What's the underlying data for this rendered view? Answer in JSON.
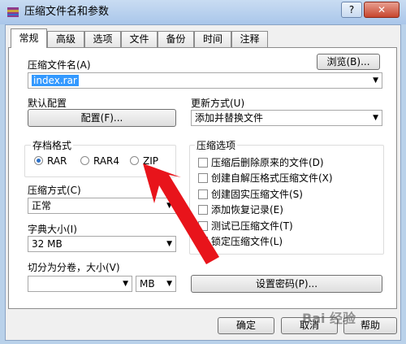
{
  "window": {
    "title": "压缩文件名和参数",
    "help_btn": "?",
    "close_btn": "✕"
  },
  "tabs": [
    "常规",
    "高级",
    "选项",
    "文件",
    "备份",
    "时间",
    "注释"
  ],
  "general": {
    "archive_name_label": "压缩文件名(A)",
    "archive_name_value": "index.rar",
    "browse_button": "浏览(B)...",
    "default_profile_label": "默认配置",
    "profiles_button": "配置(F)...",
    "update_mode_label": "更新方式(U)",
    "update_mode_value": "添加并替换文件",
    "archive_format_label": "存档格式",
    "format_options": [
      "RAR",
      "RAR4",
      "ZIP"
    ],
    "format_selected": "RAR",
    "compression_method_label": "压缩方式(C)",
    "compression_method_value": "正常",
    "dictionary_size_label": "字典大小(I)",
    "dictionary_size_value": "32 MB",
    "split_label": "切分为分卷，大小(V)",
    "split_value": "",
    "split_unit": "MB",
    "archive_options_label": "压缩选项",
    "archive_options": [
      "压缩后删除原来的文件(D)",
      "创建自解压格式压缩文件(X)",
      "创建固实压缩文件(S)",
      "添加恢复记录(E)",
      "测试已压缩文件(T)",
      "锁定压缩文件(L)"
    ],
    "set_password_button": "设置密码(P)..."
  },
  "footer": {
    "ok": "确定",
    "cancel": "取消",
    "help": "帮助"
  },
  "watermark": "Bai 经验",
  "colors": {
    "arrow": "#e8141b",
    "selection": "#3399ff",
    "titlebar": "#b9d1ea"
  }
}
